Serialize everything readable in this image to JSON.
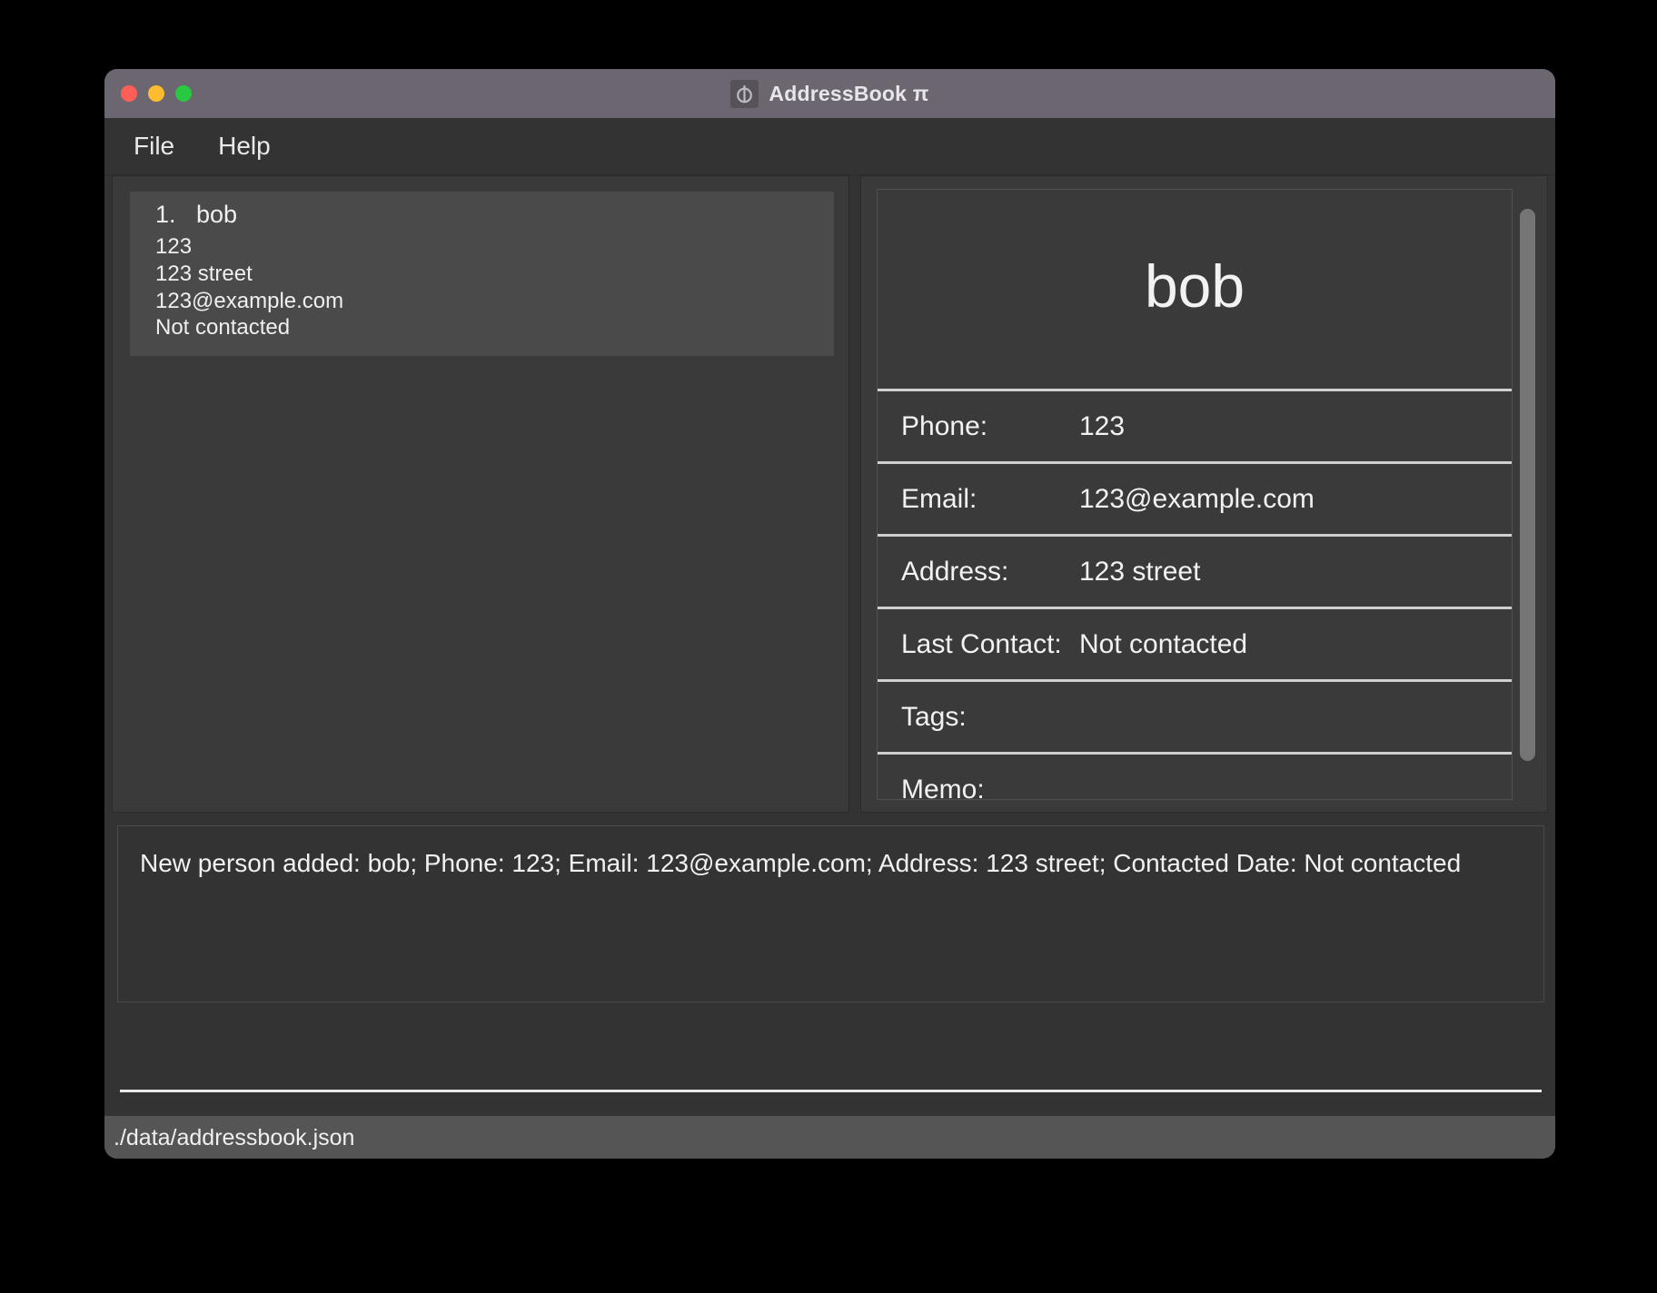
{
  "window": {
    "title": "AddressBook π",
    "app_icon": "phi-app-icon",
    "traffic_lights": [
      {
        "name": "close",
        "color": "#ff5f57"
      },
      {
        "name": "minimize",
        "color": "#febc2e"
      },
      {
        "name": "maximize",
        "color": "#28c840"
      }
    ]
  },
  "menu": {
    "items": [
      {
        "label": "File"
      },
      {
        "label": "Help"
      }
    ]
  },
  "contact_list": {
    "items": [
      {
        "index_label": "1.   bob",
        "phone": "123",
        "address": "123 street",
        "email": "123@example.com",
        "last_contact": "Not contacted",
        "selected": true
      }
    ]
  },
  "detail": {
    "name": "bob",
    "rows": [
      {
        "label": "Phone:",
        "value": "123"
      },
      {
        "label": "Email:",
        "value": "123@example.com"
      },
      {
        "label": "Address:",
        "value": "123 street"
      },
      {
        "label": "Last Contact:",
        "value": "Not contacted"
      },
      {
        "label": "Tags:",
        "value": ""
      },
      {
        "label": "Memo:",
        "value": ""
      }
    ]
  },
  "result": {
    "message": "New person added: bob; Phone: 123; Email: 123@example.com; Address: 123 street; Contacted Date: Not contacted"
  },
  "command": {
    "value": "",
    "placeholder": ""
  },
  "status": {
    "path": "./data/addressbook.json"
  },
  "colors": {
    "window_bg": "#333333",
    "titlebar_bg": "#6b6670",
    "panel_bg": "#3a3a3a",
    "selected_item_bg": "#4a4a4a",
    "divider": "#cfcfcf",
    "statusbar_bg": "#555555",
    "text": "#f1f1f1"
  }
}
